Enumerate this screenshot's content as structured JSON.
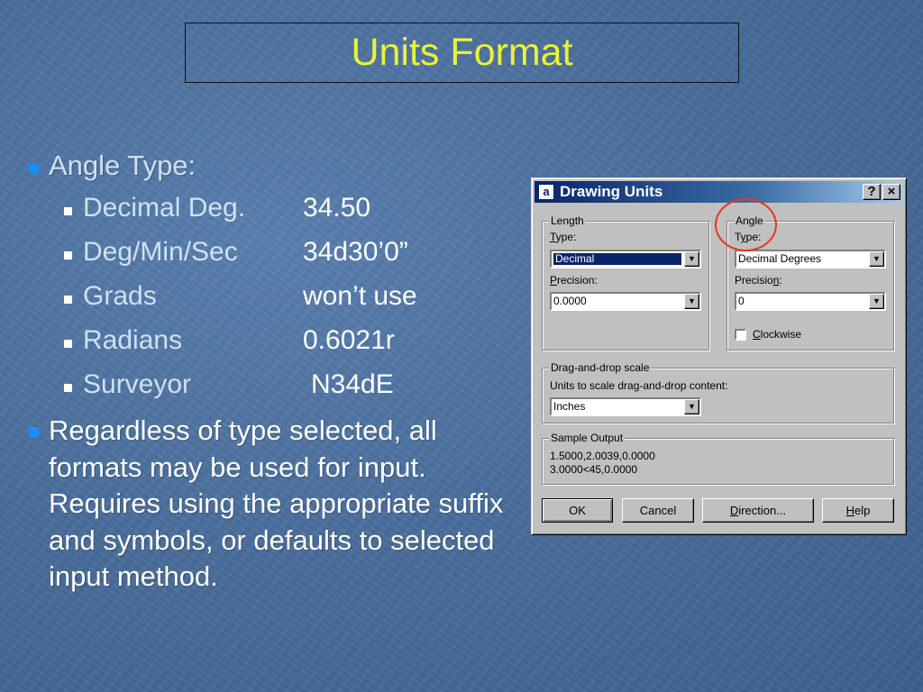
{
  "slide": {
    "title": "Units Format"
  },
  "bullets": {
    "angle_type": "Angle Type:",
    "items": [
      {
        "label": "Decimal Deg.",
        "value": "34.50"
      },
      {
        "label": "Deg/Min/Sec",
        "value": "34d30’0”"
      },
      {
        "label": "Grads",
        "value": "won’t use"
      },
      {
        "label": "Radians",
        "value": "0.6021r"
      },
      {
        "label": "Surveyor",
        "value": "N34dE"
      }
    ],
    "note": "Regardless of type selected, all formats may be used for input. Requires using the appropriate suffix and symbols, or defaults to selected input method."
  },
  "dialog": {
    "title": "Drawing Units",
    "help_button": "?",
    "close_button": "×",
    "length": {
      "legend": "Length",
      "type_label_pre": "",
      "type_label_u": "T",
      "type_label_post": "ype:",
      "type_value": "Decimal",
      "precision_label_u": "P",
      "precision_label_post": "recision:",
      "precision_value": "0.0000"
    },
    "angle": {
      "legend": "Angle",
      "type_label_pre": "T",
      "type_label_u": "y",
      "type_label_post": "pe:",
      "type_value": "Decimal Degrees",
      "precision_label_pre": "Precisio",
      "precision_label_u": "n",
      "precision_label_post": ":",
      "precision_value": "0",
      "clockwise_u": "C",
      "clockwise_post": "lockwise",
      "clockwise_checked": false
    },
    "drag_drop": {
      "legend": "Drag-and-drop scale",
      "label": "Units to scale drag-and-drop content:",
      "value": "Inches"
    },
    "sample": {
      "legend": "Sample Output",
      "line1": "1.5000,2.0039,0.0000",
      "line2": "3.0000<45,0.0000"
    },
    "buttons": {
      "ok": "OK",
      "cancel": "Cancel",
      "direction_u": "D",
      "direction_post": "irection...",
      "help_u": "H",
      "help_post": "elp"
    }
  },
  "colors": {
    "title": "#e8f23a",
    "bullet_level1": "#1a8cff",
    "highlight_circle": "#e8361b",
    "titlebar_start": "#0a246a"
  }
}
